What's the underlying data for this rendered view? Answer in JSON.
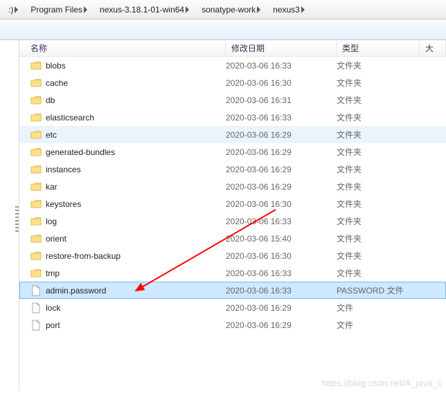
{
  "breadcrumb": {
    "items": [
      {
        "label": ":)"
      },
      {
        "label": "Program Files"
      },
      {
        "label": "nexus-3.18.1-01-win64"
      },
      {
        "label": "sonatype-work"
      },
      {
        "label": "nexus3"
      }
    ]
  },
  "columns": {
    "name": "名称",
    "date": "修改日期",
    "type": "类型",
    "size": "大"
  },
  "rows": [
    {
      "icon": "folder",
      "name": "blobs",
      "date": "2020-03-06 16:33",
      "type": "文件夹",
      "state": ""
    },
    {
      "icon": "folder",
      "name": "cache",
      "date": "2020-03-06 16:30",
      "type": "文件夹",
      "state": ""
    },
    {
      "icon": "folder",
      "name": "db",
      "date": "2020-03-06 16:31",
      "type": "文件夹",
      "state": ""
    },
    {
      "icon": "folder",
      "name": "elasticsearch",
      "date": "2020-03-06 16:33",
      "type": "文件夹",
      "state": ""
    },
    {
      "icon": "folder",
      "name": "etc",
      "date": "2020-03-06 16:29",
      "type": "文件夹",
      "state": "hover"
    },
    {
      "icon": "folder",
      "name": "generated-bundles",
      "date": "2020-03-06 16:29",
      "type": "文件夹",
      "state": ""
    },
    {
      "icon": "folder",
      "name": "instances",
      "date": "2020-03-06 16:29",
      "type": "文件夹",
      "state": ""
    },
    {
      "icon": "folder",
      "name": "kar",
      "date": "2020-03-06 16:29",
      "type": "文件夹",
      "state": ""
    },
    {
      "icon": "folder",
      "name": "keystores",
      "date": "2020-03-06 16:30",
      "type": "文件夹",
      "state": ""
    },
    {
      "icon": "folder",
      "name": "log",
      "date": "2020-03-06 16:33",
      "type": "文件夹",
      "state": ""
    },
    {
      "icon": "folder",
      "name": "orient",
      "date": "2020-03-06 15:40",
      "type": "文件夹",
      "state": ""
    },
    {
      "icon": "folder",
      "name": "restore-from-backup",
      "date": "2020-03-06 16:30",
      "type": "文件夹",
      "state": ""
    },
    {
      "icon": "folder",
      "name": "tmp",
      "date": "2020-03-06 16:33",
      "type": "文件夹",
      "state": ""
    },
    {
      "icon": "file",
      "name": "admin.password",
      "date": "2020-03-06 16:33",
      "type": "PASSWORD 文件",
      "state": "selected"
    },
    {
      "icon": "file",
      "name": "lock",
      "date": "2020-03-06 16:29",
      "type": "文件",
      "state": ""
    },
    {
      "icon": "file",
      "name": "port",
      "date": "2020-03-06 16:29",
      "type": "文件",
      "state": ""
    }
  ],
  "watermark": "https://blog.csdn.net/A_java_c"
}
